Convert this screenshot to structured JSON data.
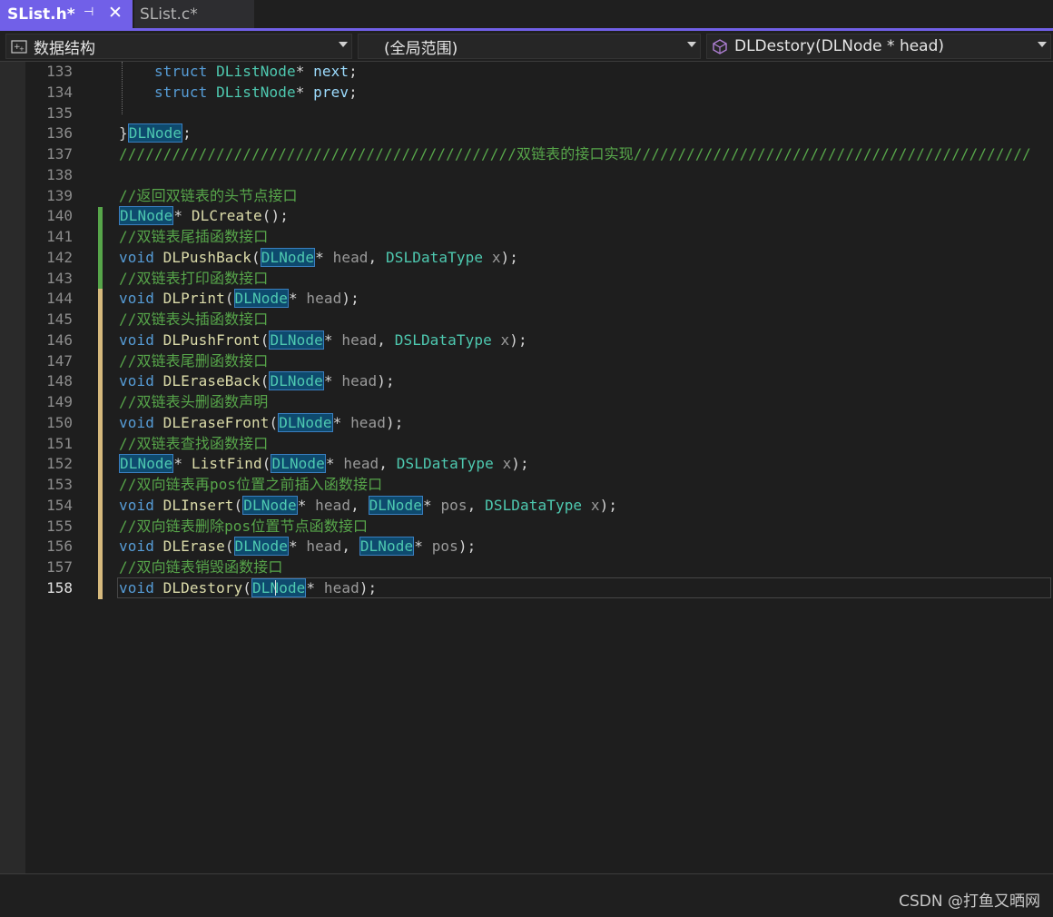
{
  "tabs": [
    {
      "label": "SList.h*",
      "active": true
    },
    {
      "label": "SList.c*",
      "active": false
    }
  ],
  "navbar": {
    "project": "数据结构",
    "scope": "(全局范围)",
    "member": "DLDestory(DLNode * head)"
  },
  "editor": {
    "lines": [
      {
        "no": "133",
        "tokens": [
          [
            "punc",
            "    "
          ],
          [
            "kw",
            "struct"
          ],
          [
            "punc",
            " "
          ],
          [
            "type",
            "DListNode"
          ],
          [
            "punc",
            "* "
          ],
          [
            "id",
            "next"
          ],
          [
            "punc",
            ";"
          ]
        ]
      },
      {
        "no": "134",
        "tokens": [
          [
            "punc",
            "    "
          ],
          [
            "kw",
            "struct"
          ],
          [
            "punc",
            " "
          ],
          [
            "type",
            "DListNode"
          ],
          [
            "punc",
            "* "
          ],
          [
            "id",
            "prev"
          ],
          [
            "punc",
            ";"
          ]
        ]
      },
      {
        "no": "135",
        "tokens": []
      },
      {
        "no": "136",
        "tokens": [
          [
            "punc",
            "}"
          ],
          [
            "hl",
            "DLNode"
          ],
          [
            "punc",
            ";"
          ]
        ]
      },
      {
        "no": "137",
        "tokens": [
          [
            "cm",
            "/////////////////////////////////////////////双链表的接口实现/////////////////////////////////////////////"
          ]
        ]
      },
      {
        "no": "138",
        "tokens": []
      },
      {
        "no": "139",
        "tokens": [
          [
            "cm",
            "//返回双链表的头节点接口"
          ]
        ]
      },
      {
        "no": "140",
        "tokens": [
          [
            "hl",
            "DLNode"
          ],
          [
            "punc",
            "* "
          ],
          [
            "fn",
            "DLCreate"
          ],
          [
            "punc",
            "();"
          ]
        ]
      },
      {
        "no": "141",
        "tokens": [
          [
            "cm",
            "//双链表尾插函数接口"
          ]
        ]
      },
      {
        "no": "142",
        "tokens": [
          [
            "kw",
            "void"
          ],
          [
            "punc",
            " "
          ],
          [
            "fn",
            "DLPushBack"
          ],
          [
            "punc",
            "("
          ],
          [
            "hl",
            "DLNode"
          ],
          [
            "punc",
            "* "
          ],
          [
            "param",
            "head"
          ],
          [
            "punc",
            ", "
          ],
          [
            "type",
            "DSLDataType"
          ],
          [
            "punc",
            " "
          ],
          [
            "param",
            "x"
          ],
          [
            "punc",
            ");"
          ]
        ]
      },
      {
        "no": "143",
        "tokens": [
          [
            "cm",
            "//双链表打印函数接口"
          ]
        ]
      },
      {
        "no": "144",
        "tokens": [
          [
            "kw",
            "void"
          ],
          [
            "punc",
            " "
          ],
          [
            "fn",
            "DLPrint"
          ],
          [
            "punc",
            "("
          ],
          [
            "hl",
            "DLNode"
          ],
          [
            "punc",
            "* "
          ],
          [
            "param",
            "head"
          ],
          [
            "punc",
            ");"
          ]
        ]
      },
      {
        "no": "145",
        "tokens": [
          [
            "cm",
            "//双链表头插函数接口"
          ]
        ]
      },
      {
        "no": "146",
        "tokens": [
          [
            "kw",
            "void"
          ],
          [
            "punc",
            " "
          ],
          [
            "fn",
            "DLPushFront"
          ],
          [
            "punc",
            "("
          ],
          [
            "hl",
            "DLNode"
          ],
          [
            "punc",
            "* "
          ],
          [
            "param",
            "head"
          ],
          [
            "punc",
            ", "
          ],
          [
            "type",
            "DSLDataType"
          ],
          [
            "punc",
            " "
          ],
          [
            "param",
            "x"
          ],
          [
            "punc",
            ");"
          ]
        ]
      },
      {
        "no": "147",
        "tokens": [
          [
            "cm",
            "//双链表尾删函数接口"
          ]
        ]
      },
      {
        "no": "148",
        "tokens": [
          [
            "kw",
            "void"
          ],
          [
            "punc",
            " "
          ],
          [
            "fn",
            "DLEraseBack"
          ],
          [
            "punc",
            "("
          ],
          [
            "hl",
            "DLNode"
          ],
          [
            "punc",
            "* "
          ],
          [
            "param",
            "head"
          ],
          [
            "punc",
            ");"
          ]
        ]
      },
      {
        "no": "149",
        "tokens": [
          [
            "cm",
            "//双链表头删函数声明"
          ]
        ]
      },
      {
        "no": "150",
        "tokens": [
          [
            "kw",
            "void"
          ],
          [
            "punc",
            " "
          ],
          [
            "fn",
            "DLEraseFront"
          ],
          [
            "punc",
            "("
          ],
          [
            "hl",
            "DLNode"
          ],
          [
            "punc",
            "* "
          ],
          [
            "param",
            "head"
          ],
          [
            "punc",
            ");"
          ]
        ]
      },
      {
        "no": "151",
        "tokens": [
          [
            "cm",
            "//双链表查找函数接口"
          ]
        ]
      },
      {
        "no": "152",
        "tokens": [
          [
            "hl",
            "DLNode"
          ],
          [
            "punc",
            "* "
          ],
          [
            "fn",
            "ListFind"
          ],
          [
            "punc",
            "("
          ],
          [
            "hl",
            "DLNode"
          ],
          [
            "punc",
            "* "
          ],
          [
            "param",
            "head"
          ],
          [
            "punc",
            ", "
          ],
          [
            "type",
            "DSLDataType"
          ],
          [
            "punc",
            " "
          ],
          [
            "param",
            "x"
          ],
          [
            "punc",
            ");"
          ]
        ]
      },
      {
        "no": "153",
        "tokens": [
          [
            "cm",
            "//双向链表再pos位置之前插入函数接口"
          ]
        ]
      },
      {
        "no": "154",
        "tokens": [
          [
            "kw",
            "void"
          ],
          [
            "punc",
            " "
          ],
          [
            "fn",
            "DLInsert"
          ],
          [
            "punc",
            "("
          ],
          [
            "hl",
            "DLNode"
          ],
          [
            "punc",
            "* "
          ],
          [
            "param",
            "head"
          ],
          [
            "punc",
            ", "
          ],
          [
            "hl",
            "DLNode"
          ],
          [
            "punc",
            "* "
          ],
          [
            "param",
            "pos"
          ],
          [
            "punc",
            ", "
          ],
          [
            "type",
            "DSLDataType"
          ],
          [
            "punc",
            " "
          ],
          [
            "param",
            "x"
          ],
          [
            "punc",
            ");"
          ]
        ]
      },
      {
        "no": "155",
        "tokens": [
          [
            "cm",
            "//双向链表删除pos位置节点函数接口"
          ]
        ]
      },
      {
        "no": "156",
        "tokens": [
          [
            "kw",
            "void"
          ],
          [
            "punc",
            " "
          ],
          [
            "fn",
            "DLErase"
          ],
          [
            "punc",
            "("
          ],
          [
            "hl",
            "DLNode"
          ],
          [
            "punc",
            "* "
          ],
          [
            "param",
            "head"
          ],
          [
            "punc",
            ", "
          ],
          [
            "hl",
            "DLNode"
          ],
          [
            "punc",
            "* "
          ],
          [
            "param",
            "pos"
          ],
          [
            "punc",
            ");"
          ]
        ]
      },
      {
        "no": "157",
        "tokens": [
          [
            "cm",
            "//双向链表销毁函数接口"
          ]
        ]
      },
      {
        "no": "158",
        "tokens": [
          [
            "kw",
            "void"
          ],
          [
            "punc",
            " "
          ],
          [
            "fn",
            "DLDestory"
          ],
          [
            "punc",
            "("
          ],
          [
            "hl",
            "DLNode"
          ],
          [
            "punc",
            "* "
          ],
          [
            "param",
            "head"
          ],
          [
            "punc",
            ");"
          ]
        ],
        "current": true
      }
    ]
  },
  "watermark": "CSDN @打鱼又晒网",
  "colors": {
    "accent": "#7160e8",
    "change_saved": "#57a64a",
    "change_unsaved": "#d7ba7d"
  },
  "icons": {
    "pin": "pin-icon",
    "close": "close-icon",
    "project": "project-icon",
    "member": "method-icon"
  }
}
